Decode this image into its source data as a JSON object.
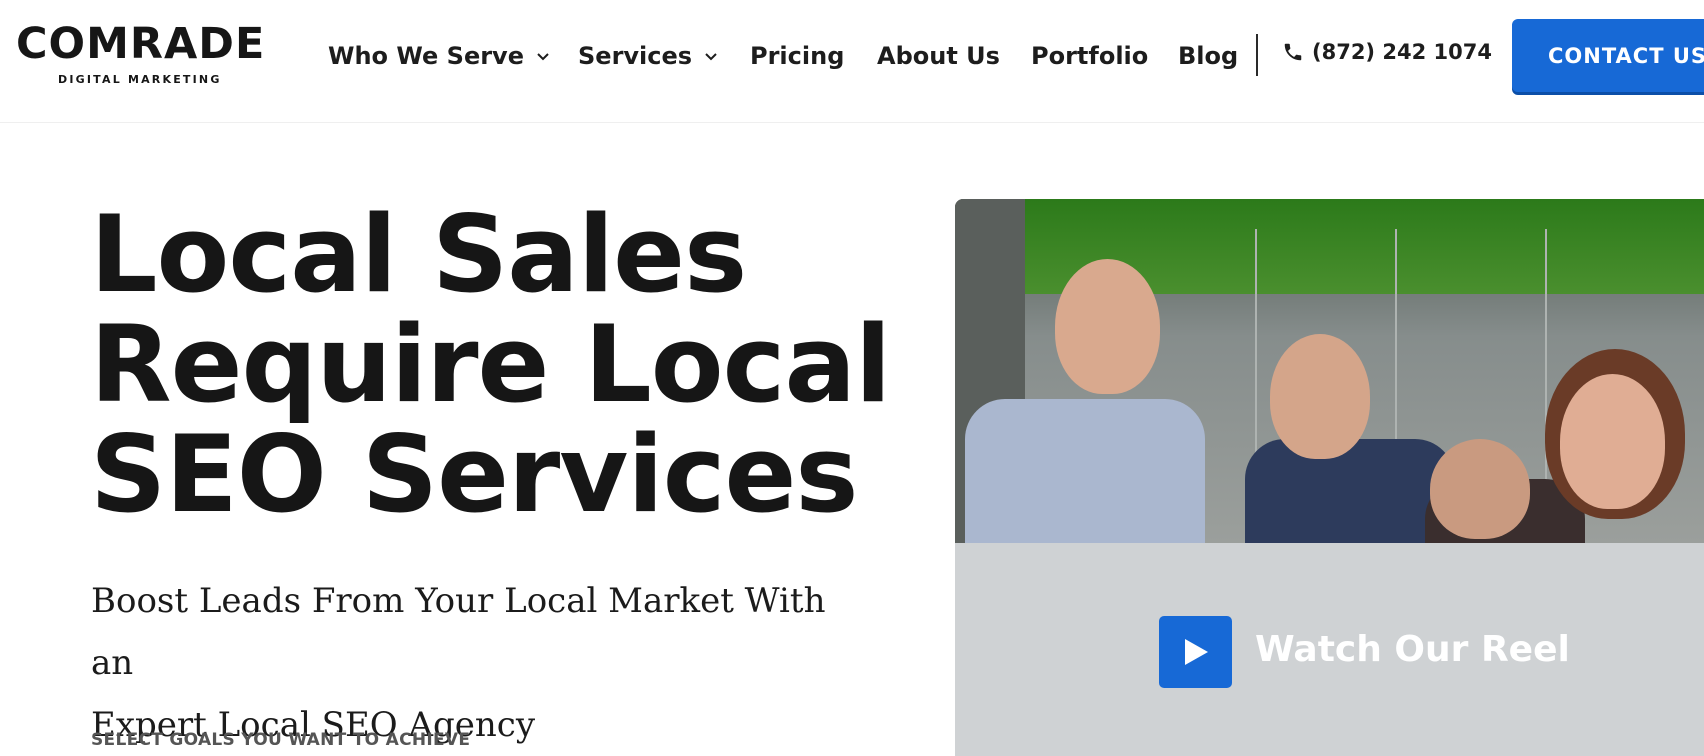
{
  "brand": {
    "name": "COMRADE",
    "tagline": "DIGITAL MARKETING"
  },
  "nav": {
    "items": [
      {
        "label": "Who We Serve",
        "has_dropdown": true
      },
      {
        "label": "Services",
        "has_dropdown": true
      },
      {
        "label": "Pricing",
        "has_dropdown": false
      },
      {
        "label": "About Us",
        "has_dropdown": false
      },
      {
        "label": "Portfolio",
        "has_dropdown": false
      },
      {
        "label": "Blog",
        "has_dropdown": false
      }
    ],
    "phone": "(872) 242 1074",
    "contact_label": "CONTACT US"
  },
  "hero": {
    "title_lines": [
      "Local Sales",
      "Require Local",
      "SEO Services"
    ],
    "subtitle_lines": [
      "Boost Leads From Your Local Market With an",
      "Expert Local SEO Agency"
    ],
    "goals_label": "SELECT GOALS YOU WANT TO ACHIEVE"
  },
  "media": {
    "reel_label": "Watch Our Reel"
  },
  "colors": {
    "accent": "#1769d6",
    "text": "#161616",
    "reel_bg": "#cfd2d4"
  }
}
